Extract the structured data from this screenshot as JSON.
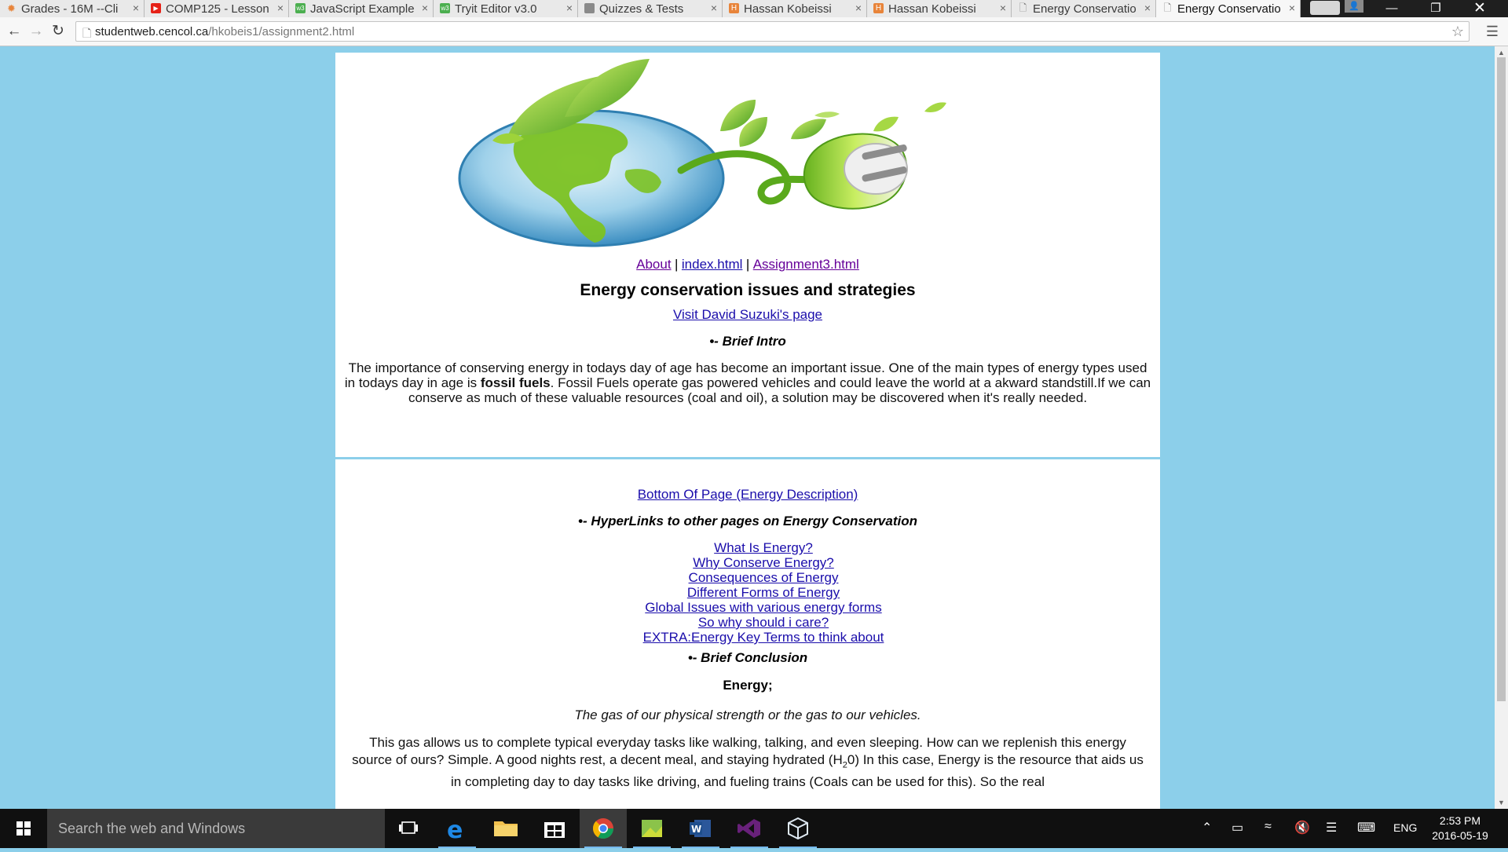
{
  "browser": {
    "tabs": [
      {
        "label": "Grades - 16M --Cli",
        "favicon": "star-icon",
        "favicon_color": "#e8843a"
      },
      {
        "label": "COMP125 - Lesson",
        "favicon": "youtube-icon",
        "favicon_color": "#e62117"
      },
      {
        "label": "JavaScript Example",
        "favicon": "w3schools-icon",
        "favicon_color": "#4caf50"
      },
      {
        "label": "Tryit Editor v3.0",
        "favicon": "w3schools-icon",
        "favicon_color": "#4caf50"
      },
      {
        "label": "Quizzes & Tests",
        "favicon": "document-icon",
        "favicon_color": "#777777"
      },
      {
        "label": "Hassan Kobeissi",
        "favicon": "html-icon",
        "favicon_color": "#e8843a"
      },
      {
        "label": "Hassan Kobeissi",
        "favicon": "html-icon",
        "favicon_color": "#e8843a"
      },
      {
        "label": "Energy Conservatio",
        "favicon": "page-icon",
        "favicon_color": "#777777"
      },
      {
        "label": "Energy Conservatio",
        "favicon": "page-icon",
        "favicon_color": "#777777",
        "active": true
      }
    ],
    "url_host": "studentweb.cencol.ca",
    "url_path": "/hkobeis1/assignment2.html"
  },
  "page": {
    "nav": {
      "about": "About",
      "sep1": "|",
      "index": "index.html",
      "sep2": "|",
      "assignment3": "Assignment3.html"
    },
    "title": "Energy conservation issues and strategies",
    "suzuki_link": "Visit David Suzuki's page",
    "bullet": "•-",
    "intro_heading": "Brief Intro",
    "intro_text_a": "The importance of conserving energy in todays day of age has become an important issue. One of the main types of energy types used in todays day in age is ",
    "intro_text_bold": "fossil fuels",
    "intro_text_b": ". Fossil Fuels operate gas powered vehicles and could leave the world at a akward standstill.If we can conserve as much of these valuable resources (coal and oil), a solution may be discovered when it's really needed.",
    "bottom_link": "Bottom Of Page (Energy Description)",
    "hyperlinks_heading": "HyperLinks to other pages on Energy Conservation",
    "links": [
      "What Is Energy?",
      "Why Conserve Energy?",
      "Consequences of Energy",
      "Different Forms of Energy",
      "Global Issues with various energy forms",
      "So why should i care?",
      "EXTRA:Energy Key Terms to think about"
    ],
    "conclusion_heading": "Brief Conclusion",
    "energy_label": "Energy;",
    "energy_tagline": "The gas of our physical strength or the gas to our vehicles.",
    "conclusion_text_a": "This gas allows us to complete typical everyday tasks like walking, talking, and even sleeping. How can we replenish this energy source of ours? Simple. A good nights rest, a decent meal, and staying hydrated (H",
    "conclusion_sub": "2",
    "conclusion_text_b": "0) In this case, Energy is the resource that aids us in completing day to day tasks like driving, and fueling trains (Coals can be used for this). So the real"
  },
  "taskbar": {
    "search_placeholder": "Search the web and Windows",
    "language": "ENG",
    "time": "2:53 PM",
    "date": "2016-05-19"
  },
  "colors": {
    "page_background": "#8ccfea",
    "link": "#1a0dab",
    "visited_link": "#660099"
  }
}
